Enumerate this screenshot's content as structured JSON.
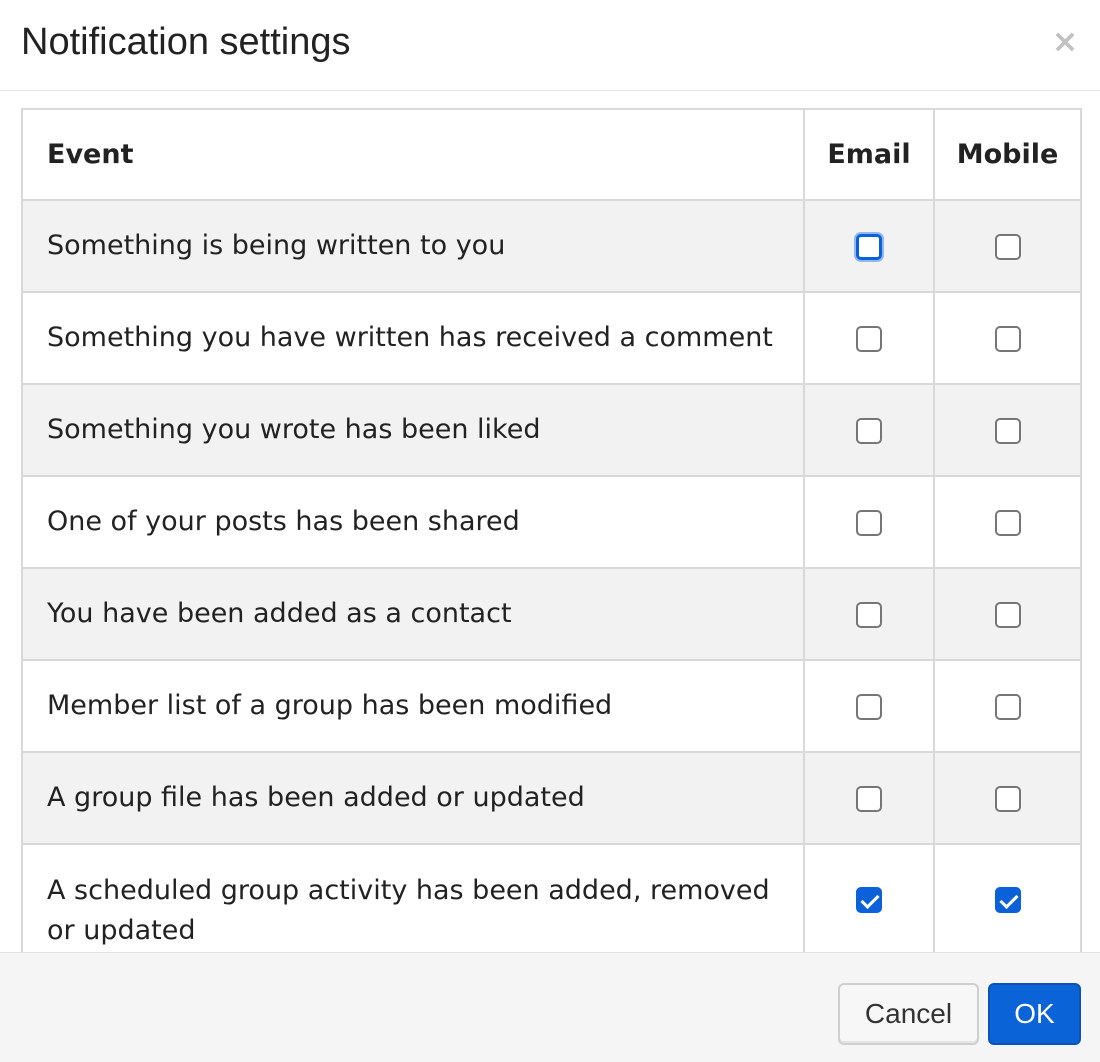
{
  "dialog": {
    "title": "Notification settings",
    "close_glyph": "×"
  },
  "table": {
    "headers": {
      "event": "Event",
      "email": "Email",
      "mobile": "Mobile"
    },
    "rows": [
      {
        "label": "Something is being written to you",
        "email": false,
        "mobile": false,
        "email_focused": true
      },
      {
        "label": "Something you have written has received a comment",
        "email": false,
        "mobile": false
      },
      {
        "label": "Something you wrote has been liked",
        "email": false,
        "mobile": false
      },
      {
        "label": "One of your posts has been shared",
        "email": false,
        "mobile": false
      },
      {
        "label": "You have been added as a contact",
        "email": false,
        "mobile": false
      },
      {
        "label": "Member list of a group has been modified",
        "email": false,
        "mobile": false
      },
      {
        "label": "A group file has been added or updated",
        "email": false,
        "mobile": false
      },
      {
        "label": "A scheduled group activity has been added, removed or updated",
        "email": true,
        "mobile": true
      }
    ]
  },
  "footer": {
    "cancel_label": "Cancel",
    "ok_label": "OK"
  },
  "colors": {
    "accent": "#0b61d9",
    "stripe": "#f2f2f2",
    "border": "#d9d9d9"
  }
}
